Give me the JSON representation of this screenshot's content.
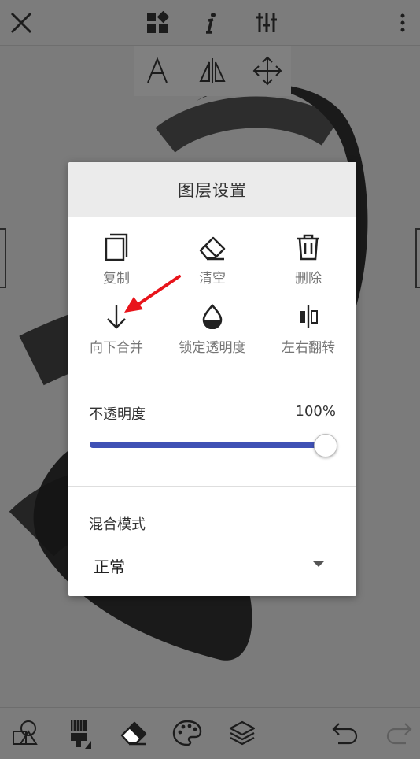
{
  "topbar": {
    "close_icon": "close-icon",
    "widgets_icon": "widgets-icon",
    "info_icon": "info-icon",
    "adjust_icon": "sliders-icon",
    "more_icon": "more-vertical-icon"
  },
  "toolstrip": {
    "text_icon": "text-tool-icon",
    "flip_icon": "mirror-icon",
    "move_icon": "move-icon"
  },
  "dialog": {
    "title": "图层设置",
    "actions": [
      {
        "label": "复制",
        "icon": "copy-icon"
      },
      {
        "label": "清空",
        "icon": "eraser-icon"
      },
      {
        "label": "删除",
        "icon": "trash-icon"
      },
      {
        "label": "向下合并",
        "icon": "arrow-down-icon"
      },
      {
        "label": "锁定透明度",
        "icon": "drop-lock-icon"
      },
      {
        "label": "左右翻转",
        "icon": "flip-horizontal-icon"
      }
    ],
    "opacity": {
      "label": "不透明度",
      "value": "100%",
      "fraction": 1.0
    },
    "blend": {
      "label": "混合模式",
      "value": "正常"
    }
  },
  "bottombar": {
    "shapes_icon": "shapes-icon",
    "brush_icon": "brush-icon",
    "eraser_icon": "eraser-icon",
    "palette_icon": "palette-icon",
    "layers_icon": "layers-icon",
    "undo_icon": "undo-icon",
    "redo_icon": "redo-icon"
  },
  "colors": {
    "accent": "#3f51b5",
    "annotation": "#e8141b"
  }
}
